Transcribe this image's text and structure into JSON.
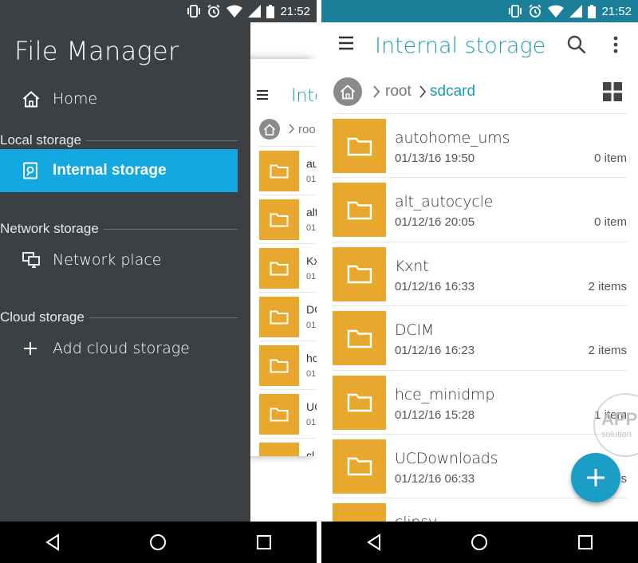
{
  "status_bar": {
    "time": "21:52"
  },
  "left_screen": {
    "drawer": {
      "title": "File Manager",
      "home_label": "Home",
      "sections": [
        {
          "label": "Local storage",
          "items": [
            {
              "label": "Internal storage",
              "icon": "internal-storage-icon",
              "active": true
            }
          ]
        },
        {
          "label": "Network storage",
          "items": [
            {
              "label": "Network place",
              "icon": "network-place-icon",
              "active": false
            }
          ]
        },
        {
          "label": "Cloud storage",
          "items": [
            {
              "label": "Add cloud storage",
              "icon": "plus-icon",
              "active": false
            }
          ]
        }
      ]
    },
    "peek": {
      "title": "Inte",
      "breadcrumb_root": "roo",
      "rows": [
        {
          "name": "au",
          "date": "01"
        },
        {
          "name": "alt",
          "date": "01"
        },
        {
          "name": "Kx",
          "date": "01"
        },
        {
          "name": "DC",
          "date": "01"
        },
        {
          "name": "hc",
          "date": "01"
        },
        {
          "name": "UC",
          "date": "01"
        },
        {
          "name": "cl",
          "date": ""
        }
      ]
    }
  },
  "right_screen": {
    "app_bar": {
      "title": "Internal storage"
    },
    "breadcrumb": {
      "root": "root",
      "current": "sdcard"
    },
    "files": [
      {
        "name": "autohome_ums",
        "date": "01/13/16 19:50",
        "count": "0 item"
      },
      {
        "name": "alt_autocycle",
        "date": "01/12/16 20:05",
        "count": "0 item"
      },
      {
        "name": "Kxnt",
        "date": "01/12/16 16:33",
        "count": "2 items"
      },
      {
        "name": "DCIM",
        "date": "01/12/16 16:23",
        "count": "2 items"
      },
      {
        "name": "hce_minidmp",
        "date": "01/12/16 15:28",
        "count": "1 item"
      },
      {
        "name": "UCDownloads",
        "date": "01/12/16 06:33",
        "count": "s"
      },
      {
        "name": "clipsy",
        "date": "",
        "count": ""
      }
    ],
    "watermark": {
      "line1": "APP",
      "line2": "solution"
    }
  },
  "colors": {
    "accent": "#1c9bb9",
    "folder": "#e8a82d",
    "drawer_bg": "#3d4043",
    "drawer_active": "#14a8e0",
    "fab": "#1a9ec6"
  }
}
